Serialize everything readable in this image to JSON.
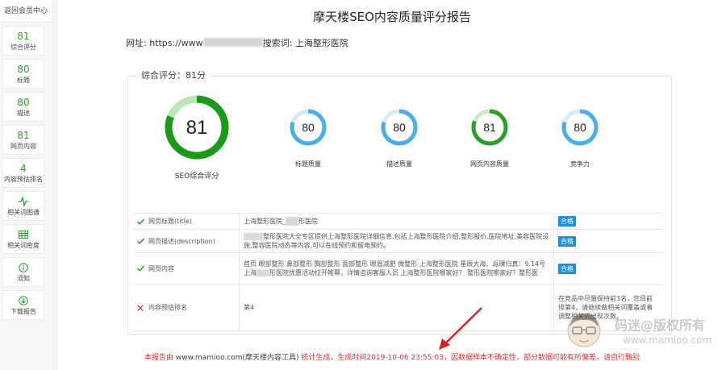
{
  "sidebar": {
    "back_label": "返回会员中心",
    "items": [
      {
        "num": "81",
        "label": "综合评分"
      },
      {
        "num": "80",
        "label": "标题"
      },
      {
        "num": "80",
        "label": "描述"
      },
      {
        "num": "81",
        "label": "网页内容"
      },
      {
        "num": "4",
        "label": "内容预估排名"
      },
      {
        "icon": "pulse-icon",
        "label": "相关词图谱"
      },
      {
        "icon": "table-icon",
        "label": "相关词密度"
      },
      {
        "icon": "info-icon",
        "label": "须知"
      },
      {
        "icon": "download-icon",
        "label": "下载报告"
      }
    ]
  },
  "report": {
    "title": "摩天楼SEO内容质量评分报告",
    "url_prefix": "网址: https://www",
    "keyword_label": "搜索词: 上海整形医院",
    "score_legend": "综合评分：81分",
    "main_score": {
      "value": "81",
      "label": "SEO综合评分",
      "percent": 81
    },
    "gauges": [
      {
        "value": "80",
        "label": "标题质量",
        "percent": 80,
        "color": "#4aaee8"
      },
      {
        "value": "80",
        "label": "描述质量",
        "percent": 80,
        "color": "#4aaee8"
      },
      {
        "value": "81",
        "label": "网页内容质量",
        "percent": 81,
        "color": "#2aa02a"
      },
      {
        "value": "80",
        "label": "竞争力",
        "percent": 80,
        "color": "#4aaee8"
      }
    ]
  },
  "table": {
    "rows": [
      {
        "status": "ok",
        "name": "网页标题(title)",
        "value_pre": "上海整形医院_",
        "value_post": "形医院",
        "result": "合格"
      },
      {
        "status": "ok",
        "name": "网页描述(description)",
        "value_pre": "",
        "value_post": "整形医院大全专区提供上海整形医院详细信息,包括上海整形医院介绍,整形报价,医院地址,美容医院设施,整容医院动态等内容,可以在线预约和留电预约。",
        "result": "合格"
      },
      {
        "status": "ok",
        "name": "网页内容",
        "value_pre": "首页 眼部整形 鼻部整形 胸部整形 面部整形 眼眉减肥 微整形 上海整形医院 星辰大海、返璞归真：9.14号上海",
        "value_post": "形医院优惠活动拉开帷幕，详情咨询客服人员 上海整形医院哪家好？ 整形医院哪家好？整形医",
        "result": "合格"
      },
      {
        "status": "fail",
        "name": "内容预估排名",
        "value_pre": "第4",
        "value_post": "",
        "result": "在竞品中尽量保持前3名，您目前排第4，请继续做相关词覆盖或者调整相关词出现次数。"
      }
    ]
  },
  "footer": {
    "pre": "本报告由 ",
    "site": "www.mamioo.com(摩天楼内容工具)",
    "post": " 统计生成，生成时间2019-10-06 23:55:03，因数据样本不确定性，部分数据可能有所偏差，请自行甄别"
  },
  "watermark": {
    "text": "码迷@版权所有",
    "url": "www.mamioo.com"
  },
  "colors": {
    "green": "#2aa02a",
    "blue": "#4aaee8",
    "red": "#e03030",
    "badge": "#1e90e0"
  }
}
